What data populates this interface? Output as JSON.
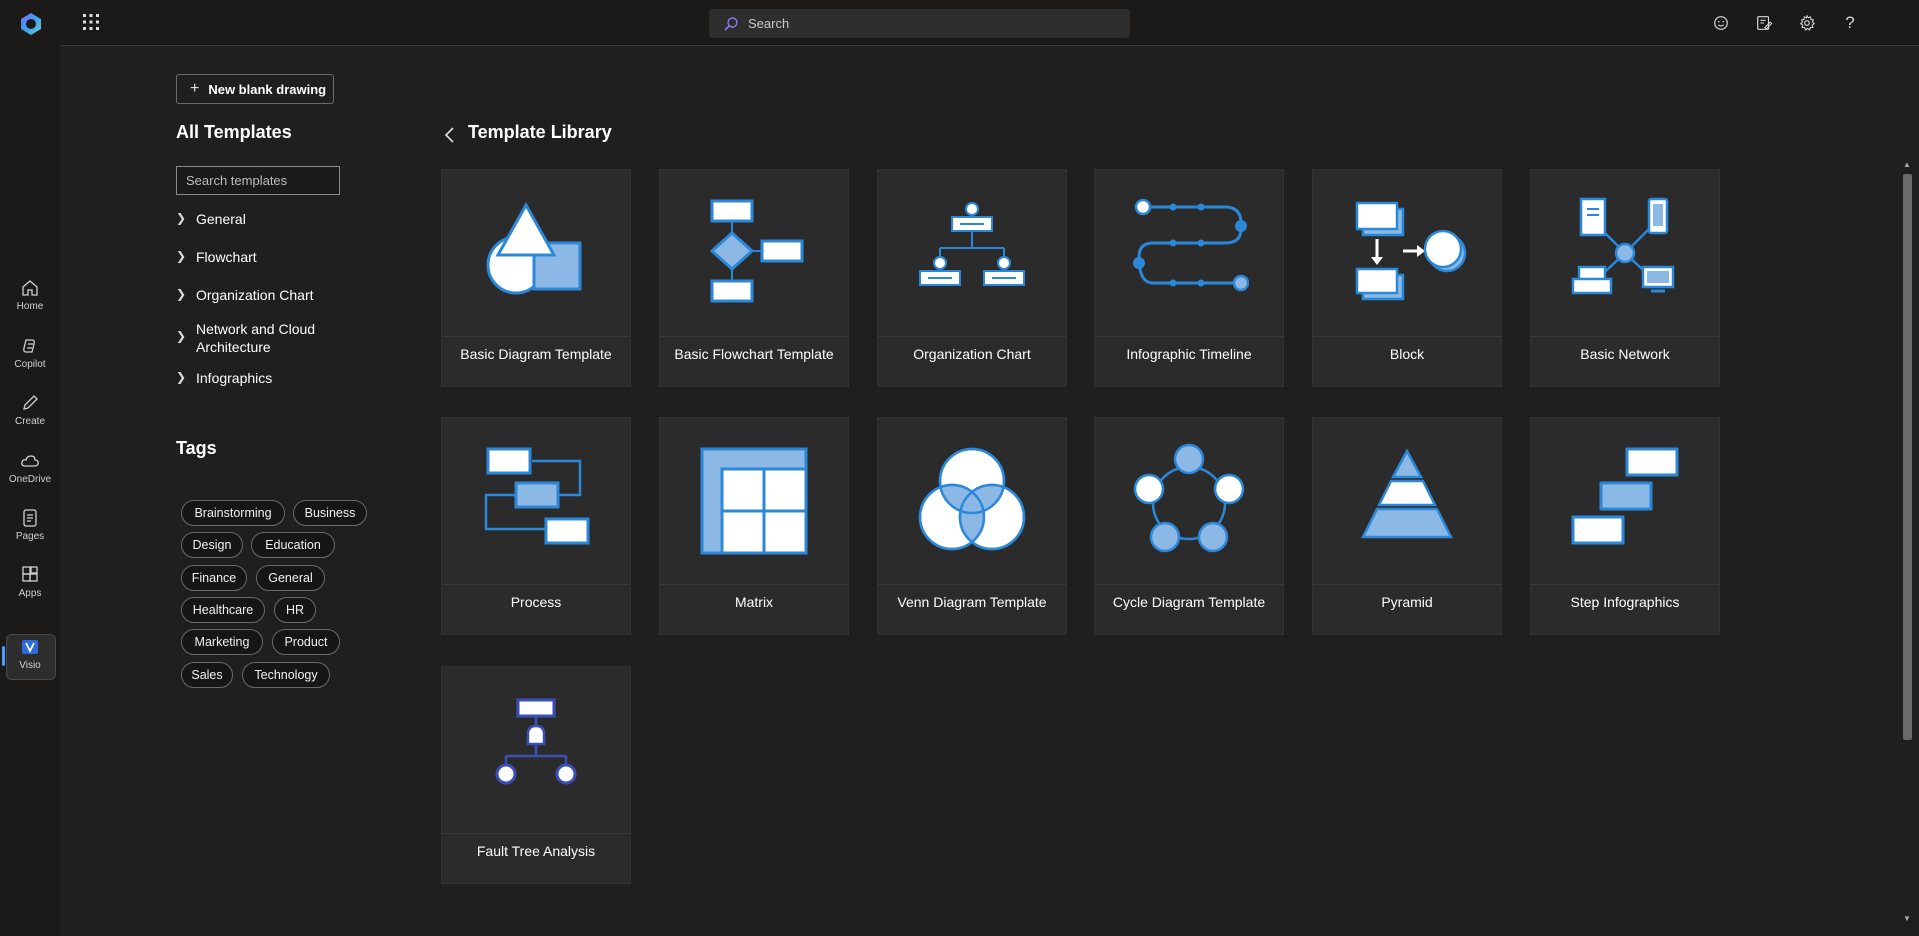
{
  "rail": {
    "items": [
      {
        "label": "Home",
        "icon": "home-icon"
      },
      {
        "label": "Copilot",
        "icon": "copilot-icon"
      },
      {
        "label": "Create",
        "icon": "pen-icon"
      },
      {
        "label": "OneDrive",
        "icon": "cloud-icon"
      },
      {
        "label": "Pages",
        "icon": "pages-icon"
      },
      {
        "label": "Apps",
        "icon": "apps-icon"
      },
      {
        "label": "Visio",
        "icon": "visio-icon"
      }
    ]
  },
  "topbar": {
    "search_placeholder": "Search",
    "icons": [
      "feedback-icon",
      "whats-new-icon",
      "settings-icon",
      "help-icon"
    ],
    "help_glyph": "?"
  },
  "left_panel": {
    "new_button": "New blank drawing",
    "all_templates_heading": "All Templates",
    "search_placeholder": "Search templates",
    "categories": [
      "General",
      "Flowchart",
      "Organization Chart",
      "Network and Cloud Architecture",
      "Infographics"
    ],
    "tags_heading": "Tags",
    "tags": [
      "Brainstorming",
      "Business",
      "Design",
      "Education",
      "Finance",
      "General",
      "Healthcare",
      "HR",
      "Marketing",
      "Product",
      "Sales",
      "Technology"
    ]
  },
  "main": {
    "title": "Template Library",
    "templates": [
      "Basic Diagram Template",
      "Basic Flowchart Template",
      "Organization Chart",
      "Infographic Timeline",
      "Block",
      "Basic Network",
      "Process",
      "Matrix",
      "Venn Diagram Template",
      "Cycle Diagram Template",
      "Pyramid",
      "Step Infographics",
      "Fault Tree Analysis"
    ]
  },
  "colors": {
    "accent": "#2b88d8",
    "accent_fill": "#8cb8e6",
    "background": "#1f1f1f",
    "card": "#2b2b2b"
  }
}
